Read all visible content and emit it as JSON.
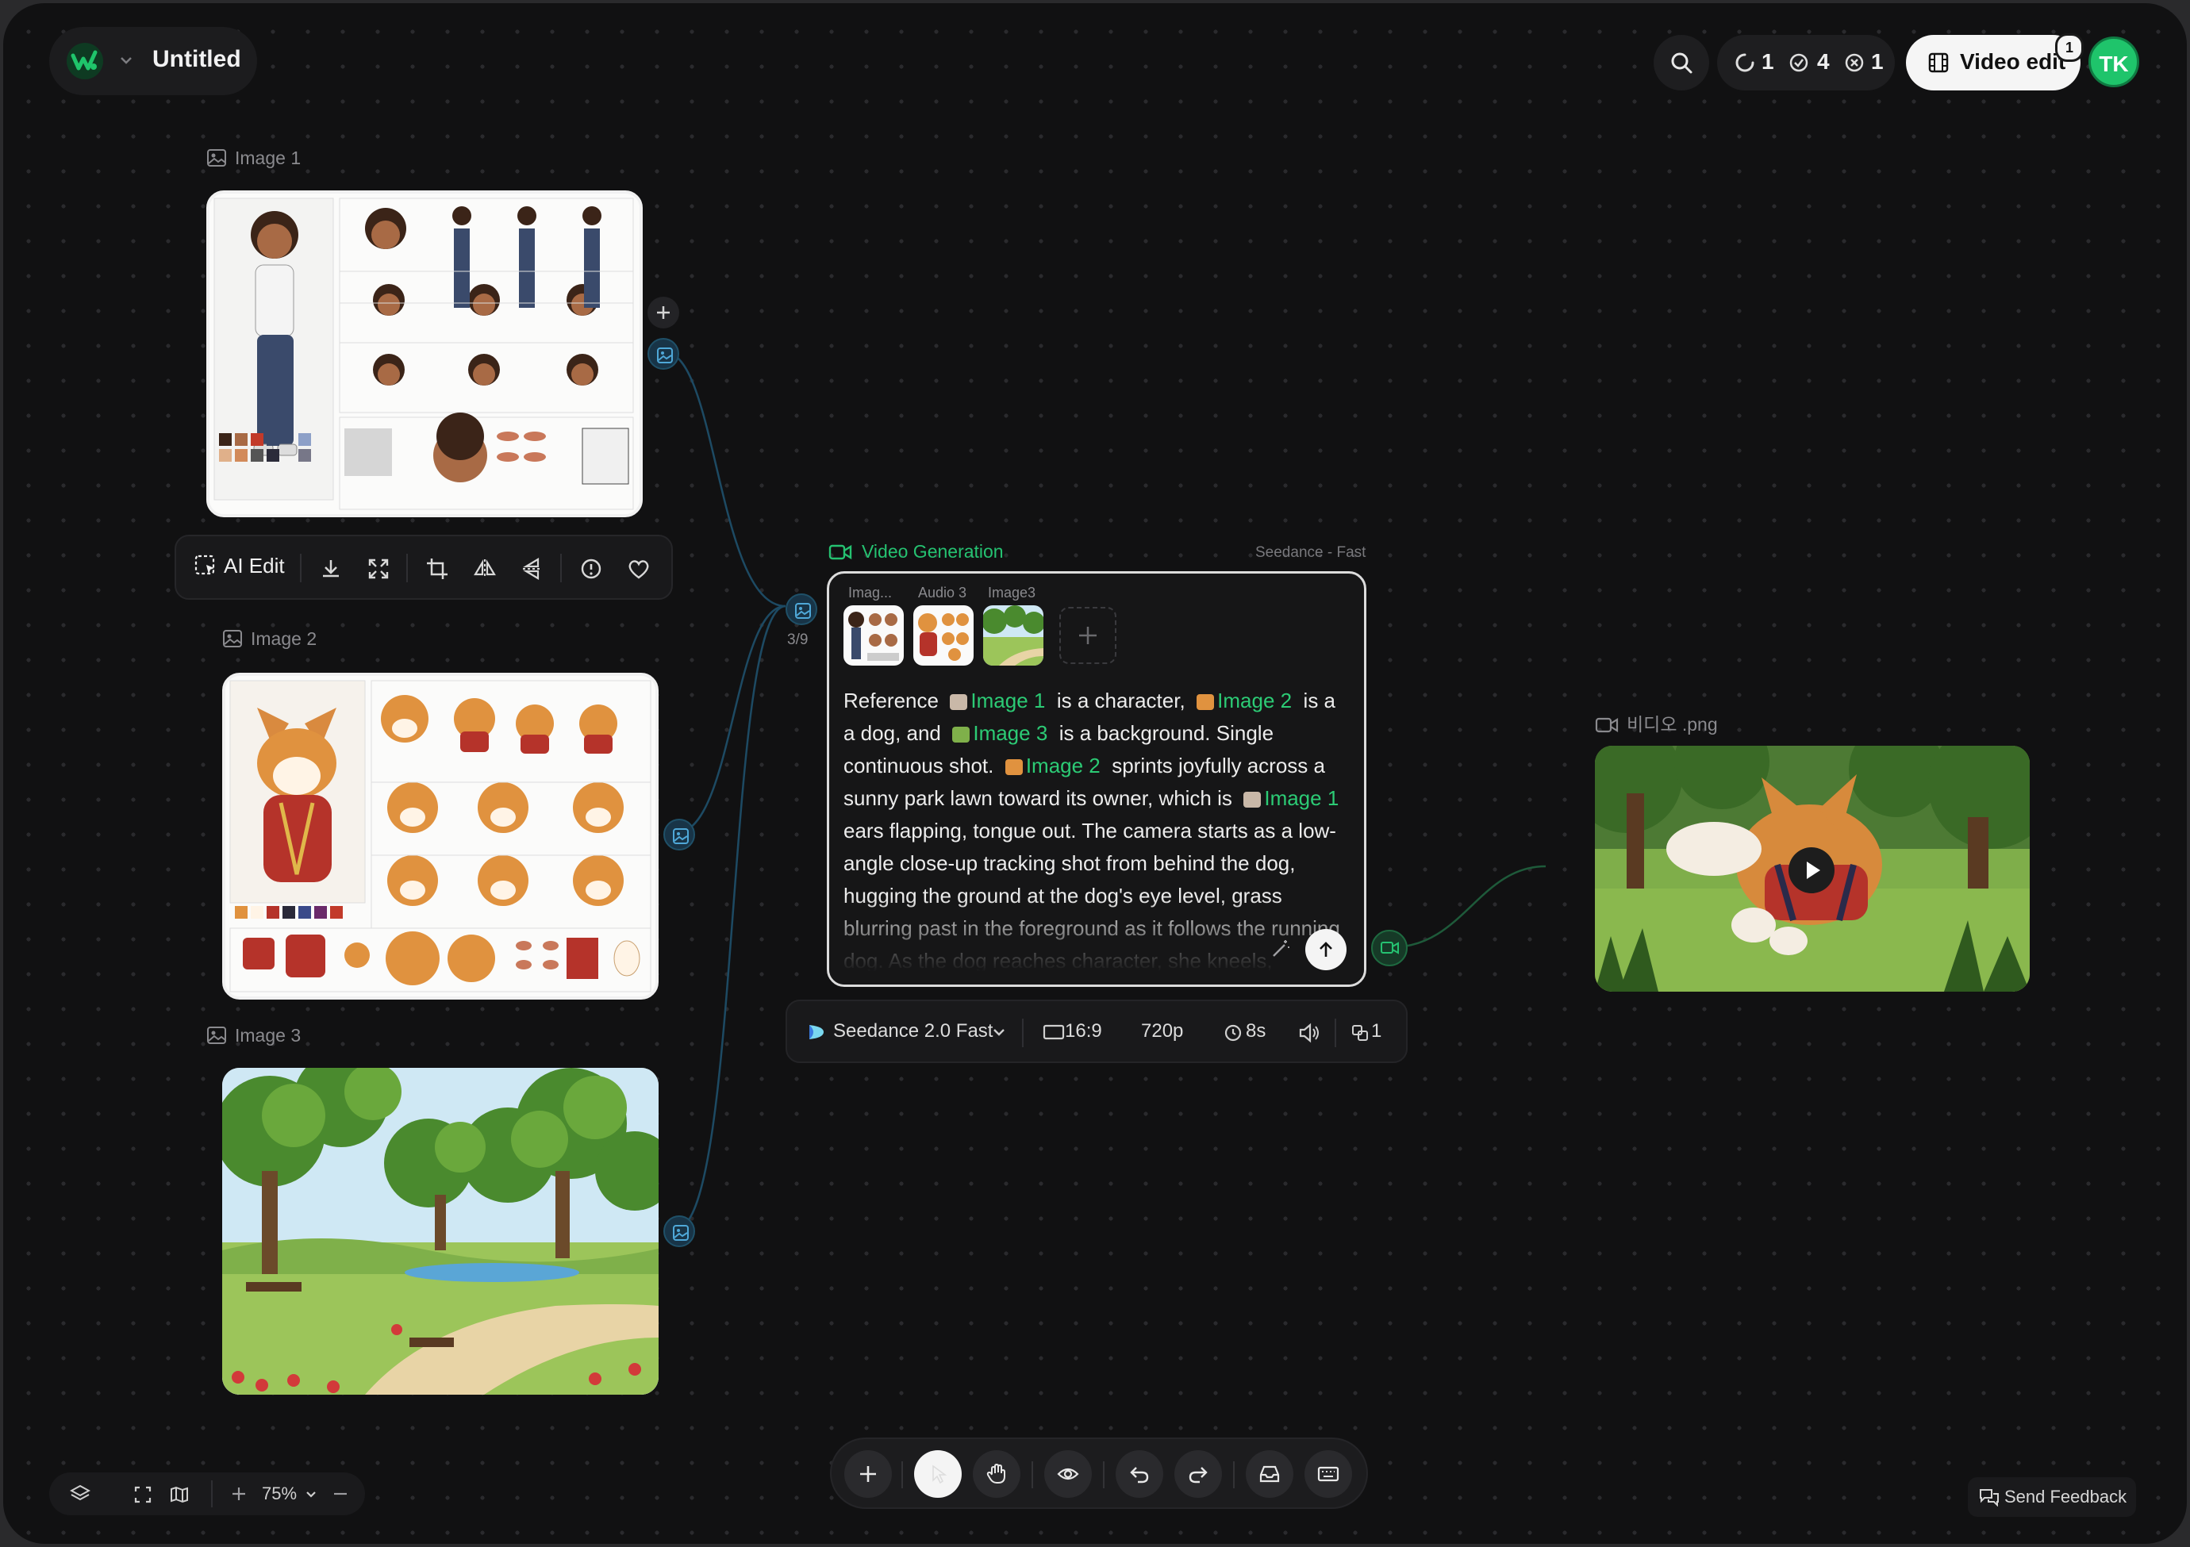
{
  "header": {
    "title": "Untitled",
    "status": {
      "running": "1",
      "done": "4",
      "failed": "1"
    },
    "video_edit_label": "Video edit",
    "video_edit_badge": "1",
    "avatar_initials": "TK",
    "brand_color": "#1fc46b"
  },
  "nodes": {
    "image1": {
      "label": "Image 1"
    },
    "image2": {
      "label": "Image 2"
    },
    "image3": {
      "label": "Image 3"
    },
    "output": {
      "label": "비디오 .png"
    }
  },
  "toolbar": {
    "ai_edit_label": "AI Edit",
    "icons": [
      "download-icon",
      "expand-icon",
      "crop-icon",
      "flip-horizontal-icon",
      "flip-vertical-icon",
      "info-icon",
      "heart-icon"
    ]
  },
  "video_generation": {
    "title": "Video Generation",
    "model_tag": "Seedance - Fast",
    "input_count": "3/9",
    "references": [
      {
        "label": "Imag..."
      },
      {
        "label": "Audio 3"
      },
      {
        "label": "Image3"
      }
    ],
    "prompt": {
      "t1": "Reference",
      "chip1": "Image 1",
      "t2": "is a character,",
      "chip2": "Image 2",
      "t3": "is a a dog, and",
      "chip3": "Image 3",
      "t4": "is a background. Single continuous shot.",
      "chip4": "Image 2",
      "t5": "sprints joyfully across a sunny park lawn toward its owner, which is",
      "chip5": "Image 1",
      "t6": "ears flapping, tongue out. The camera starts as a low-angle close-up tracking shot from behind the dog, hugging the ground at the dog's eye level, grass blurring past in the foreground as it follows the running dog. As the dog reaches character, she kneels, reaches out with both arms and the dog leaps"
    }
  },
  "settings": {
    "model": "Seedance 2.0 Fast",
    "aspect": "16:9",
    "resolution": "720p",
    "duration": "8s",
    "count": "1"
  },
  "bottom": {
    "zoom": "75%",
    "feedback": "Send Feedback"
  }
}
